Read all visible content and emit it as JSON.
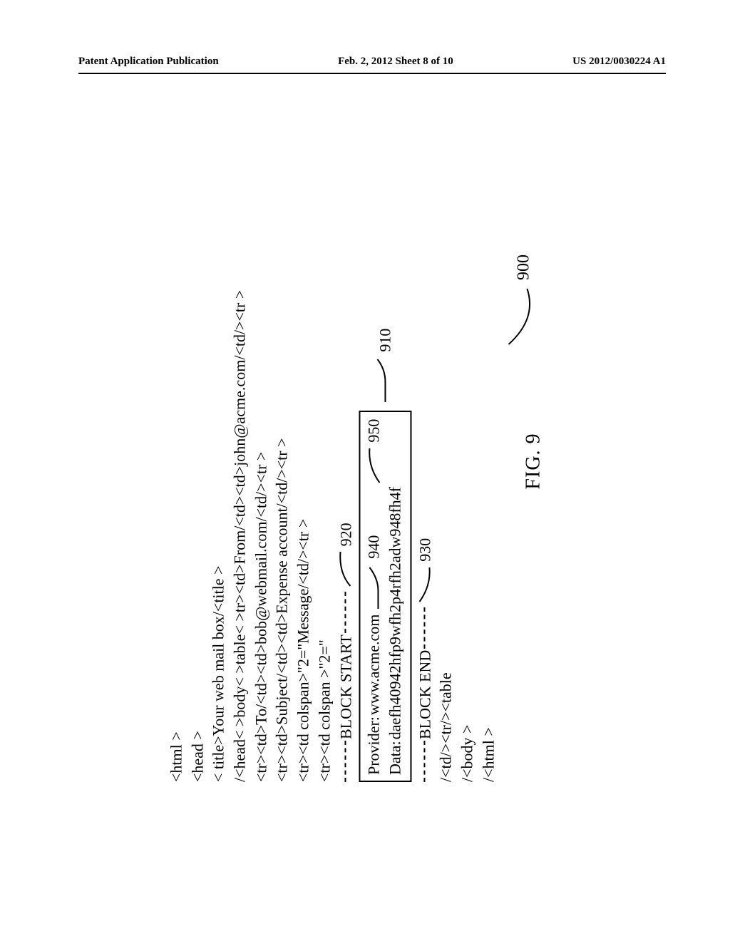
{
  "header": {
    "left": "Patent Application Publication",
    "center": "Feb. 2, 2012  Sheet 8 of 10",
    "right": "US 2012/0030224 A1"
  },
  "code": {
    "l1": "<html >",
    "l2": "<head >",
    "l3": "< title>Your web mail box/<title >",
    "l4": "/<head< >body< >table< >tr><td>From/<td><td>john@acme.com/<td/><tr >",
    "l5": "<tr><td>To/<td><td>bob@webmail.com/<td/><tr >",
    "l6": "<tr><td>Subject/<td><td>Expense account/<td/><tr >",
    "l7": "<tr><td colspan>\"2=\"Message/<td/><tr >",
    "l8": "<tr><td colspan >\"2=\"",
    "block_start": "BLOCK START",
    "provider_label": "Provider: ",
    "provider_value": "www.acme.com",
    "data_label": "Data: ",
    "data_value": "daefh40942hfp9wfh2p4rfh2adw948fh4f",
    "block_end": "BLOCK END",
    "l_after1": "/<td/><tr/><table",
    "l_after2": "/<body >",
    "l_after3": "/<html >"
  },
  "callouts": {
    "c920": "920",
    "c940": "940",
    "c950": "950",
    "c930": "930",
    "c910": "910",
    "c900": "900"
  },
  "figure_caption": "FIG. 9"
}
